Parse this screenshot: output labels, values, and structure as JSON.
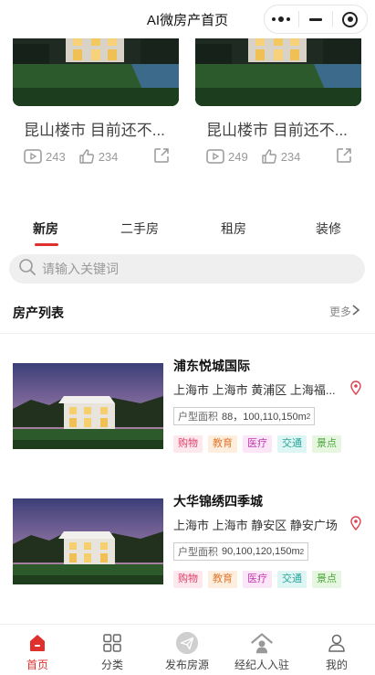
{
  "header": {
    "title": "AI微房产首页"
  },
  "videos": [
    {
      "title": "昆山楼市 目前还不...",
      "plays": "243",
      "likes": "234"
    },
    {
      "title": "昆山楼市 目前还不...",
      "plays": "249",
      "likes": "234"
    }
  ],
  "tabs": [
    {
      "label": "新房",
      "active": true
    },
    {
      "label": "二手房",
      "active": false
    },
    {
      "label": "租房",
      "active": false
    },
    {
      "label": "装修",
      "active": false
    }
  ],
  "search": {
    "placeholder": "请输入关键词"
  },
  "section": {
    "title": "房产列表",
    "more": "更多"
  },
  "listings": [
    {
      "name": "浦东悦城国际",
      "address": "上海市 上海市 黄浦区 上海福...",
      "area_label": "户型面积",
      "area_value": "88，100,110,150m",
      "area_unit_sup": "2",
      "tags": [
        "购物",
        "教育",
        "医疗",
        "交通",
        "景点"
      ]
    },
    {
      "name": "大华锦绣四季城",
      "address": "上海市 上海市 静安区 静安广场",
      "area_label": "户型面积",
      "area_value": "90,100,120,150m",
      "area_unit_sup": "2",
      "tags": [
        "购物",
        "教育",
        "医疗",
        "交通",
        "景点"
      ]
    }
  ],
  "tag_colors": [
    {
      "bg": "#fde8ee",
      "fg": "#e0406a"
    },
    {
      "bg": "#fdeede",
      "fg": "#e07a30"
    },
    {
      "bg": "#fbe6f7",
      "fg": "#c43ab0"
    },
    {
      "bg": "#ddf5f3",
      "fg": "#2aa59a"
    },
    {
      "bg": "#e6f6e0",
      "fg": "#4aa83a"
    }
  ],
  "bottom_nav": [
    {
      "label": "首页",
      "icon": "home-icon",
      "active": true
    },
    {
      "label": "分类",
      "icon": "grid-icon",
      "active": false
    },
    {
      "label": "发布房源",
      "icon": "send-icon",
      "active": false
    },
    {
      "label": "经纪人入驻",
      "icon": "house-person-icon",
      "active": false
    },
    {
      "label": "我的",
      "icon": "user-icon",
      "active": false
    }
  ],
  "colors": {
    "accent": "#e0302e"
  }
}
